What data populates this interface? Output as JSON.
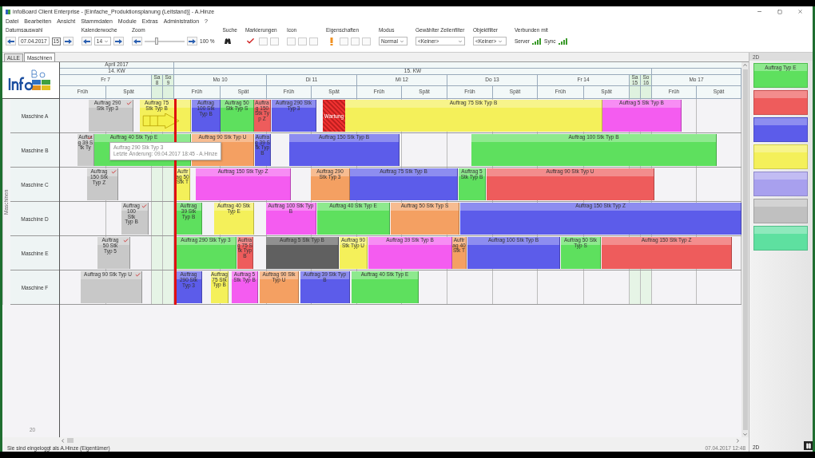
{
  "window": {
    "title": "infoBoard Client Enterprise - [Einfache_Produktionsplanung (Leitstand)] - A.Hinze"
  },
  "menu": [
    "Datei",
    "Bearbeiten",
    "Ansicht",
    "Stammdaten",
    "Module",
    "Extras",
    "Administration",
    "?"
  ],
  "toolbar": {
    "date_label": "Datumsauswahl",
    "date": "07.04.2017",
    "calendar_day": "15",
    "week_label": "Kalenderwoche",
    "week": "14",
    "zoom_label": "Zoom",
    "zoom": {
      "level": 0.3
    },
    "zoom_reading": "100 %",
    "search_label": "Suche",
    "marks_label": "Markierungen",
    "icon_label": "Icon",
    "props_label": "Eigenschaften",
    "mode_label": "Modus",
    "mode": "Normal",
    "row_filter_label": "Gewählter Zeilenfilter",
    "row_filter": "<Keiner>",
    "object_filter_label": "Objektfilter",
    "object_filter": "<Keiner>",
    "connected_label": "Verbunden mit",
    "server": "Server",
    "sync": "Sync"
  },
  "tabs": [
    {
      "label": "ALLE",
      "selected": false
    },
    {
      "label": "Maschinen",
      "selected": true
    }
  ],
  "timeline": {
    "month": "April 2017",
    "weeks": [
      "14. KW",
      "15. KW"
    ],
    "days": [
      {
        "label": "Fr 7",
        "kind": "workday",
        "shifts": [
          "Früh",
          "Spät"
        ]
      },
      {
        "label": "Sa 8",
        "kind": "weekend"
      },
      {
        "label": "So 9",
        "kind": "weekend"
      },
      {
        "label": "Mo 10",
        "kind": "workday",
        "shifts": [
          "Früh",
          "Spät"
        ]
      },
      {
        "label": "Di 11",
        "kind": "workday",
        "shifts": [
          "Früh",
          "Spät"
        ]
      },
      {
        "label": "Mi 12",
        "kind": "workday",
        "shifts": [
          "Früh",
          "Spät"
        ]
      },
      {
        "label": "Do 13",
        "kind": "workday",
        "shifts": [
          "Früh",
          "Spät"
        ]
      },
      {
        "label": "Fr 14",
        "kind": "workday",
        "shifts": [
          "Früh",
          "Spät"
        ]
      },
      {
        "label": "Sa 15",
        "kind": "weekend"
      },
      {
        "label": "So 16",
        "kind": "weekend"
      },
      {
        "label": "Mo 17",
        "kind": "workday",
        "shifts": [
          "Früh",
          "Spät"
        ]
      }
    ]
  },
  "rows_title": "Maschinen",
  "rows": [
    {
      "name": "Maschine A",
      "bars": [
        {
          "label": "Auftrag 290 Stk Typ 3",
          "kind": "order",
          "color": "#c8c8c8",
          "checked": true
        },
        {
          "label": "Auftrag 75 Stk Typ B",
          "kind": "order",
          "color": "#f4f05a",
          "checked": false
        },
        {
          "label": "Auftrag 100 Stk Typ B",
          "kind": "order",
          "color": "#5c5cea",
          "checked": false
        },
        {
          "label": "Auftrag 50 Stk Typ S",
          "kind": "order",
          "color": "#5ee05e",
          "checked": false
        },
        {
          "label": "Auftrag 150 Stk Typ Z",
          "kind": "order",
          "color": "#ee5c5c",
          "checked": false
        },
        {
          "label": "Auftrag 290 Stk Typ 3",
          "kind": "order",
          "color": "#5c5cea",
          "checked": false
        },
        {
          "label": "Wartung",
          "kind": "maintenance",
          "color": "#ee3030",
          "checked": false
        },
        {
          "label": "Auftrag 75 Stk Typ B",
          "kind": "order",
          "color": "#f4f05a",
          "checked": false
        },
        {
          "label": "Auftrag 5 Stk Typ B",
          "kind": "order",
          "color": "#f45cf0",
          "checked": false
        }
      ]
    },
    {
      "name": "Maschine B",
      "bars": [
        {
          "label": "Auftrag 39 Stk Ty",
          "kind": "order",
          "color": "#c8c8c8",
          "checked": true
        },
        {
          "label": "Auftrag 40 Stk Typ E",
          "kind": "order",
          "color": "#5ee05e",
          "checked": false
        },
        {
          "label": "Auftrag 90 Stk Typ U",
          "kind": "order",
          "color": "#f4a062",
          "checked": false
        },
        {
          "label": "Auftrag 39 Stk Typ B",
          "kind": "order",
          "color": "#5c5cea",
          "checked": false
        },
        {
          "label": "Auftrag 150 Stk Typ B",
          "kind": "order",
          "color": "#5c5cea",
          "checked": false
        },
        {
          "label": "Auftrag 100 Stk Typ B",
          "kind": "order",
          "color": "#5ee05e",
          "checked": false
        }
      ]
    },
    {
      "name": "Maschine C",
      "bars": [
        {
          "label": "Auftrag 150 Stk Typ Z",
          "kind": "order",
          "color": "#c8c8c8",
          "checked": true
        },
        {
          "label": "Auftrag 50 Stk T",
          "kind": "order",
          "color": "#f4f05a",
          "checked": false
        },
        {
          "label": "Auftrag 150 Stk Typ Z",
          "kind": "order",
          "color": "#f45cf0",
          "checked": false
        },
        {
          "label": "Auftrag 290 Stk Typ 3",
          "kind": "order",
          "color": "#f4a062",
          "checked": false
        },
        {
          "label": "Auftrag 75 Stk Typ B",
          "kind": "order",
          "color": "#5c5cea",
          "checked": false
        },
        {
          "label": "Auftrag 5 Stk Typ B",
          "kind": "order",
          "color": "#5ee05e",
          "checked": false
        },
        {
          "label": "Auftrag 90 Stk Typ U",
          "kind": "order",
          "color": "#ee5c5c",
          "checked": false
        }
      ]
    },
    {
      "name": "Maschine D",
      "bars": [
        {
          "label": "Auftrag 100 Stk Typ B",
          "kind": "order",
          "color": "#c8c8c8",
          "checked": true
        },
        {
          "label": "Auftrag 39 Stk Typ B",
          "kind": "order",
          "color": "#5ee05e",
          "checked": false
        },
        {
          "label": "Auftrag 40 Stk Typ E",
          "kind": "order",
          "color": "#f4f05a",
          "checked": false
        },
        {
          "label": "Auftrag 100 Stk Typ B",
          "kind": "order",
          "color": "#f45cf0",
          "checked": false
        },
        {
          "label": "Auftrag 40 Stk Typ E",
          "kind": "order",
          "color": "#5ee05e",
          "checked": false
        },
        {
          "label": "Auftrag 50 Stk Typ S",
          "kind": "order",
          "color": "#f4a062",
          "checked": false
        },
        {
          "label": "Auftrag 150 Stk Typ Z",
          "kind": "order",
          "color": "#5c5cea",
          "checked": false
        }
      ]
    },
    {
      "name": "Maschine E",
      "bars": [
        {
          "label": "Auftrag 50 Stk Typ 5",
          "kind": "order",
          "color": "#c8c8c8",
          "checked": true
        },
        {
          "label": "Auftrag 290 Stk Typ 3",
          "kind": "order",
          "color": "#5ee05e",
          "checked": false
        },
        {
          "label": "Auftrag 75 Stk Typ B",
          "kind": "order",
          "color": "#ee5c5c",
          "checked": false
        },
        {
          "label": "Auftrag 5 Stk Typ B",
          "kind": "order",
          "color": "#606060",
          "checked": false
        },
        {
          "label": "Auftrag 90 Stk Typ U",
          "kind": "order",
          "color": "#f4f05a",
          "checked": false
        },
        {
          "label": "Auftrag 39 Stk Typ B",
          "kind": "order",
          "color": "#f45cf0",
          "checked": false
        },
        {
          "label": "Auftrag 40 Stk T",
          "kind": "order",
          "color": "#f4a062",
          "checked": false
        },
        {
          "label": "Auftrag 100 Stk Typ B",
          "kind": "order",
          "color": "#5c5cea",
          "checked": false
        },
        {
          "label": "Auftrag 50 Stk Typ S",
          "kind": "order",
          "color": "#5ee05e",
          "checked": false
        },
        {
          "label": "Auftrag 150 Stk Typ Z",
          "kind": "order",
          "color": "#ee5c5c",
          "checked": false
        }
      ]
    },
    {
      "name": "Maschine F",
      "bars": [
        {
          "label": "Auftrag 90 Stk Typ U",
          "kind": "order",
          "color": "#c8c8c8",
          "checked": true
        },
        {
          "label": "Auftrag 290 Stk Typ 3",
          "kind": "order",
          "color": "#5c5cea",
          "checked": false
        },
        {
          "label": "Auftrag 75 Stk Typ B",
          "kind": "order",
          "color": "#f4f05a",
          "checked": false
        },
        {
          "label": "Auftrag 5 Stk Typ B",
          "kind": "order",
          "color": "#f45cf0",
          "checked": false
        },
        {
          "label": "Auftrag 90 Stk Typ U",
          "kind": "order",
          "color": "#f4a062",
          "checked": false
        },
        {
          "label": "Auftrag 39 Stk Typ B",
          "kind": "order",
          "color": "#5c5cea",
          "checked": false
        },
        {
          "label": "Auftrag 40 Stk Typ E",
          "kind": "order",
          "color": "#5ee05e",
          "checked": false
        }
      ]
    }
  ],
  "tooltip": {
    "title": "Auftrag 290 Stk Typ 3",
    "detail": "Letzte Änderung: 09.04.2017 18:45 - A.Hinze"
  },
  "row_footer": "20",
  "legend": {
    "title": "2D",
    "items": [
      {
        "label": "Auftrag Typ E",
        "color": "#5ee05e"
      },
      {
        "color": "#ee5c5c"
      },
      {
        "color": "#5c5cea"
      },
      {
        "color": "#f4f05a"
      },
      {
        "color": "#a8a0ee"
      },
      {
        "color": "#c0c0c0"
      },
      {
        "color": "#5ee0a0"
      }
    ],
    "footer": "2D"
  },
  "status": {
    "left": "Sie sind eingeloggt als A.Hinze (Eigentümer)",
    "right": "07.04.2017 12:48"
  }
}
